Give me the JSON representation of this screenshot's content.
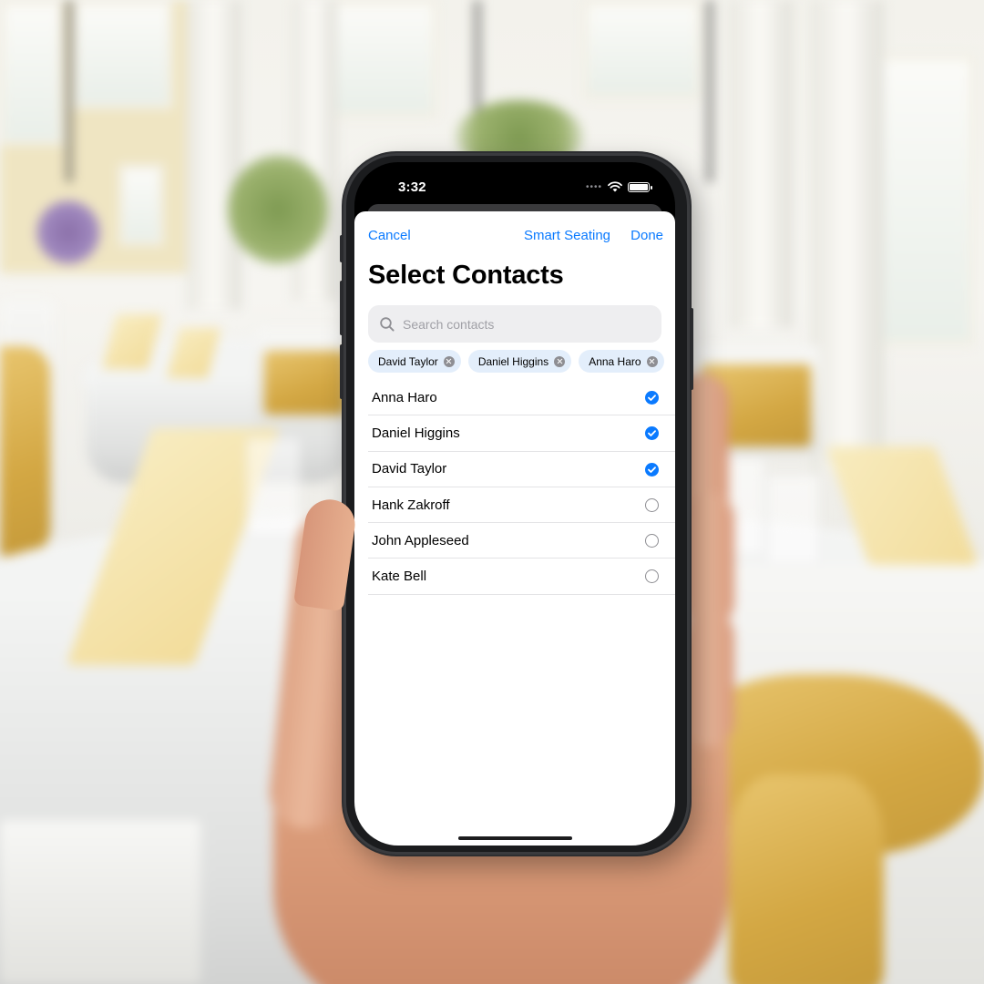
{
  "status_bar": {
    "time": "3:32",
    "signal_dots": "••••"
  },
  "nav": {
    "cancel": "Cancel",
    "smart_seating": "Smart Seating",
    "done": "Done"
  },
  "title": "Select Contacts",
  "search": {
    "placeholder": "Search contacts",
    "value": ""
  },
  "selected_chips": [
    {
      "name": "David Taylor"
    },
    {
      "name": "Daniel Higgins"
    },
    {
      "name": "Anna Haro"
    }
  ],
  "contacts": [
    {
      "name": "Anna Haro",
      "selected": true
    },
    {
      "name": "Daniel Higgins",
      "selected": true
    },
    {
      "name": "David Taylor",
      "selected": true
    },
    {
      "name": "Hank Zakroff",
      "selected": false
    },
    {
      "name": "John Appleseed",
      "selected": false
    },
    {
      "name": "Kate Bell",
      "selected": false
    }
  ],
  "colors": {
    "accent": "#0a7aff",
    "chip_bg": "#e3eefb",
    "search_bg": "#eeeef0"
  }
}
